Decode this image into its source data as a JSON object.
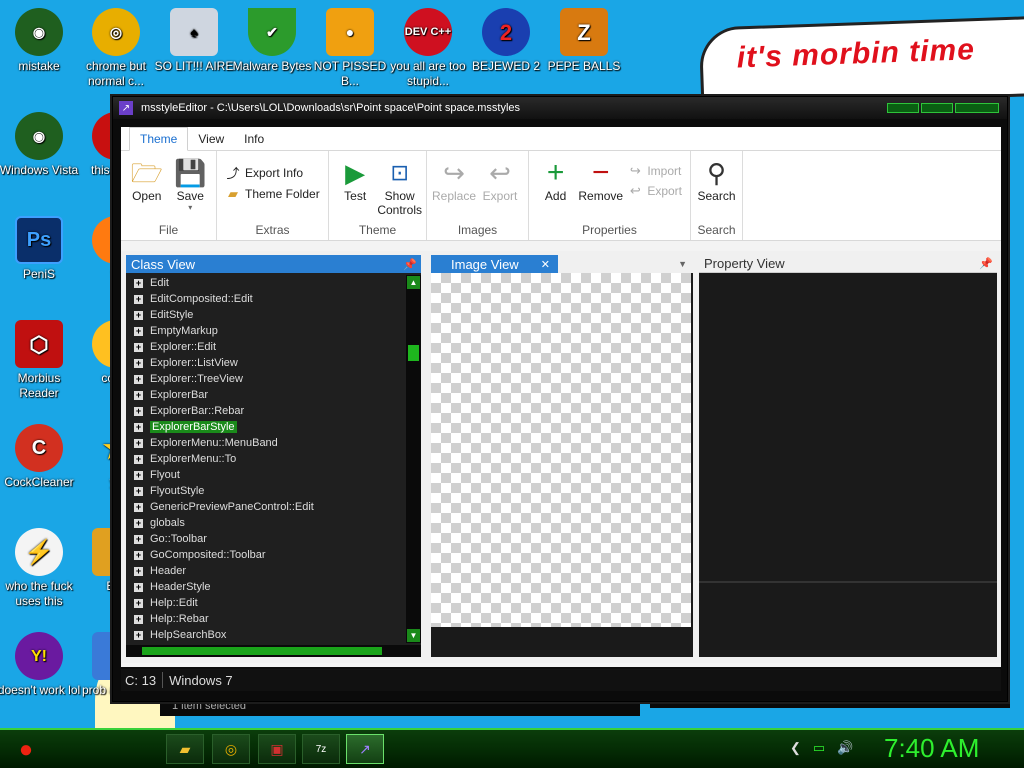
{
  "desktop": {
    "icons": [
      {
        "label": "mistake",
        "glyph": "◉",
        "color": "#1f5f1f",
        "icon": "razer-icon"
      },
      {
        "label": "chrome but normal c...",
        "glyph": "◎",
        "color": "#e8ae00",
        "icon": "chrome-icon"
      },
      {
        "label": "SO LIT!!! AIRE",
        "glyph": "♠",
        "color": "#cfd6e0",
        "icon": "solitaire-icon"
      },
      {
        "label": "Malware Bytes",
        "glyph": "✔",
        "color": "#2c9b2c",
        "icon": "shield-icon"
      },
      {
        "label": "NOT PISSED B...",
        "glyph": "🐷",
        "color": "#f0a010",
        "icon": "pig-icon"
      },
      {
        "label": "you all are too stupid...",
        "glyph": "DEV C++",
        "color": "#cf1020",
        "icon": "devcpp-icon"
      },
      {
        "label": "BEJEWED 2",
        "glyph": "2",
        "color": "#1a3fb0",
        "icon": "bejeweled-icon"
      },
      {
        "label": "PEPE BALLS",
        "glyph": "Z",
        "color": "#d87a10",
        "icon": "zuma-icon"
      },
      {
        "label": "Windows Vista",
        "glyph": "◉",
        "color": "#1f5f1f",
        "icon": "razer-icon-2"
      },
      {
        "label": "PeniS",
        "glyph": "Ps",
        "color": "#0a2f6a",
        "icon": "photoshop-icon"
      },
      {
        "label": "Morbius Reader",
        "glyph": "⬡",
        "color": "#c01010",
        "icon": "acrobat-icon"
      },
      {
        "label": "CockCleaner",
        "glyph": "C",
        "color": "#d23020",
        "icon": "ccleaner-icon"
      },
      {
        "label": "who the fuck uses this",
        "glyph": "⚡",
        "color": "#f4f4f4",
        "icon": "flash-icon"
      },
      {
        "label": "doesn't work lol",
        "glyph": "Y!",
        "color": "#6a1aa0",
        "icon": "yahoo-icon"
      }
    ],
    "partial_labels": [
      "this like a",
      "fu",
      "co go",
      "yo",
      "B B",
      "prob a rogue"
    ],
    "morbin_text": "it's morbin time"
  },
  "window": {
    "title": "msstyleEditor - C:\\Users\\LOL\\Downloads\\sr\\Point space\\Point space.msstyles",
    "tabs": [
      "Theme",
      "View",
      "Info"
    ],
    "ribbon": {
      "file": {
        "label": "File",
        "open": "Open",
        "save": "Save"
      },
      "extras": {
        "label": "Extras",
        "export_info": "Export Info",
        "theme_folder": "Theme Folder"
      },
      "theme": {
        "label": "Theme",
        "test": "Test",
        "show_controls": "Show Controls"
      },
      "images": {
        "label": "Images",
        "replace": "Replace",
        "export": "Export"
      },
      "properties": {
        "label": "Properties",
        "add": "Add",
        "remove": "Remove",
        "import": "Import",
        "export": "Export"
      },
      "search": {
        "label": "Search",
        "search": "Search"
      }
    },
    "class_view": {
      "title": "Class View",
      "items": [
        "Edit",
        "EditComposited::Edit",
        "EditStyle",
        "EmptyMarkup",
        "Explorer::Edit",
        "Explorer::ListView",
        "Explorer::TreeView",
        "ExplorerBar",
        "ExplorerBar::Rebar",
        "ExplorerBarStyle",
        "ExplorerMenu::MenuBand",
        "ExplorerMenu::To",
        "Flyout",
        "FlyoutStyle",
        "GenericPreviewPaneControl::Edit",
        "globals",
        "Go::Toolbar",
        "GoComposited::Toolbar",
        "Header",
        "HeaderStyle",
        "Help::Edit",
        "Help::Rebar",
        "HelpSearchBox"
      ],
      "selected": "ExplorerBarStyle"
    },
    "image_view": {
      "title": "Image View"
    },
    "property_view": {
      "title": "Property View"
    },
    "status": {
      "count": "C: 13",
      "platform": "Windows 7"
    }
  },
  "background_window": {
    "status": "1 item selected"
  },
  "taskbar": {
    "clock": "7:40 AM",
    "buttons": [
      "folder-icon",
      "chrome-icon",
      "media-icon",
      "7zip-icon",
      "msstyle-icon"
    ]
  }
}
